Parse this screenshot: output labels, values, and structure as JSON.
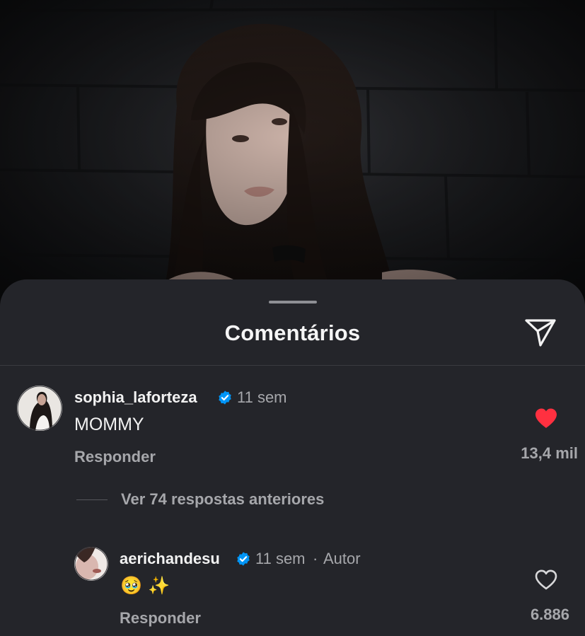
{
  "sheet": {
    "title": "Comentários",
    "share_icon": "send-icon"
  },
  "comments": [
    {
      "username": "sophia_laforteza",
      "verified": true,
      "time": "11 sem",
      "text": "MOMMY",
      "reply_label": "Responder",
      "liked": true,
      "likes": "13,4 mil",
      "like_color": "#ff3040"
    }
  ],
  "view_replies": {
    "label": "Ver 74 respostas anteriores"
  },
  "replies": [
    {
      "username": "aerichandesu",
      "verified": true,
      "time": "11 sem",
      "author_tag": "Autor",
      "text": "🥹 ✨",
      "reply_label": "Responder",
      "liked": false,
      "likes": "6.886"
    }
  ],
  "colors": {
    "sheet_bg": "#24252a",
    "verified_blue": "#0095f6",
    "muted_text": "#a6a7ab"
  }
}
